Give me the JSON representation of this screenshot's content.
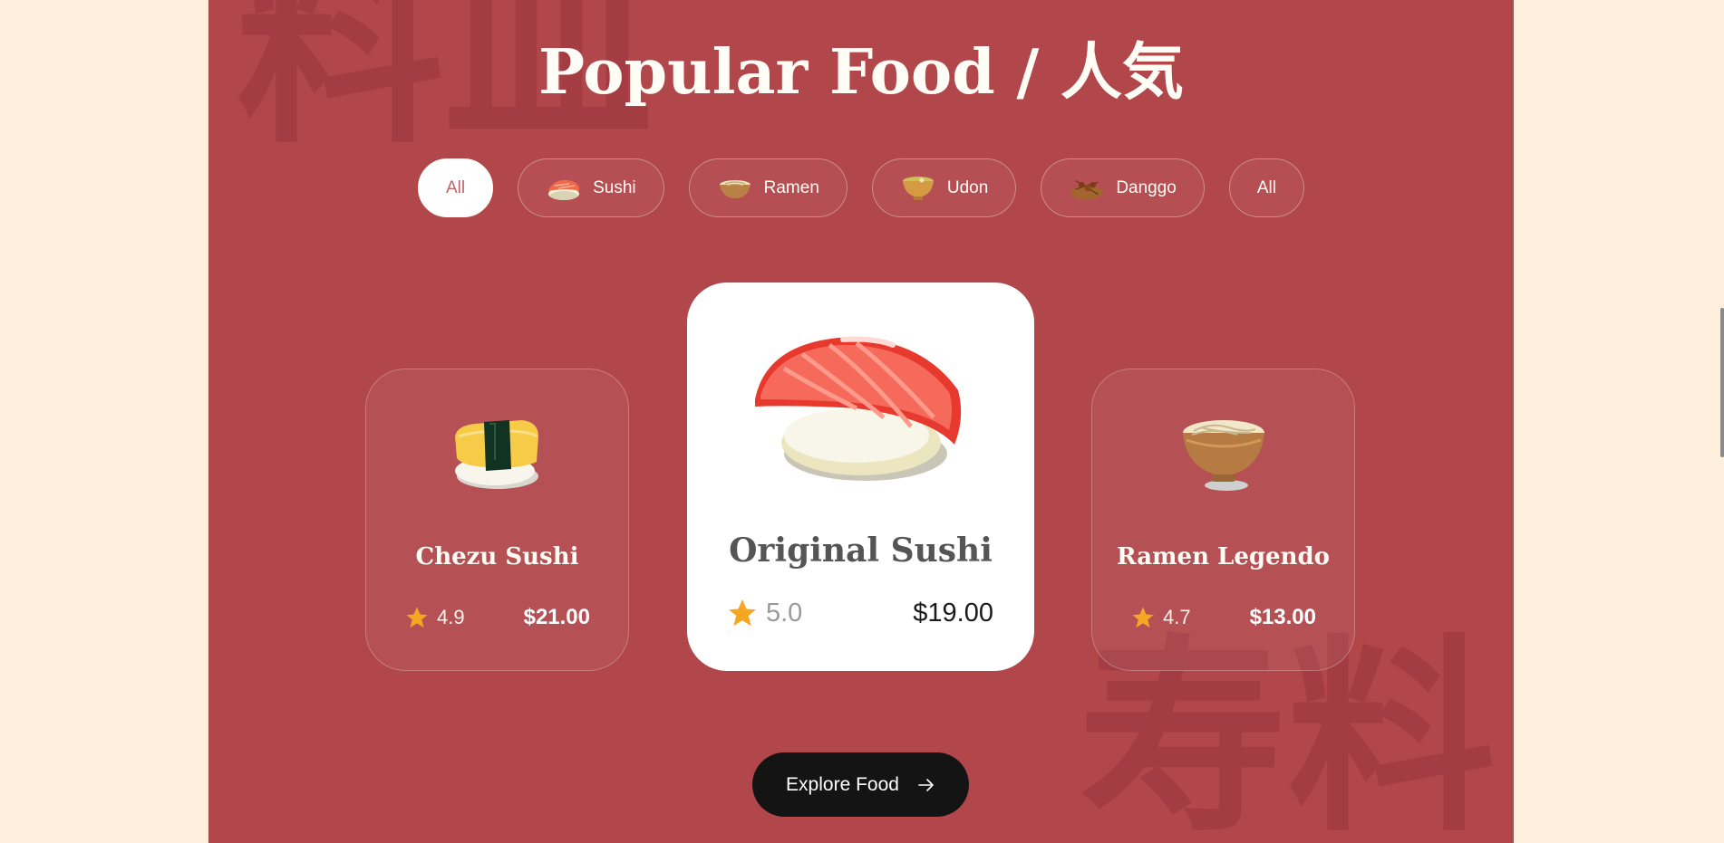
{
  "header": {
    "title": "Popular Food / 人気"
  },
  "background_kanji": {
    "top_left": "料皿",
    "bottom_right": "寿料"
  },
  "filters": [
    {
      "label": "All",
      "icon": "",
      "active": true
    },
    {
      "label": "Sushi",
      "icon": "sushi-icon",
      "active": false
    },
    {
      "label": "Ramen",
      "icon": "ramen-bowl-icon",
      "active": false
    },
    {
      "label": "Udon",
      "icon": "udon-bowl-icon",
      "active": false
    },
    {
      "label": "Danggo",
      "icon": "dango-plate-icon",
      "active": false
    },
    {
      "label": "All",
      "icon": "",
      "active": false
    }
  ],
  "cards": [
    {
      "name": "Chezu Sushi",
      "rating": "4.9",
      "price": "$21.00",
      "image": "tamago-sushi-image"
    },
    {
      "name": "Original Sushi",
      "rating": "5.0",
      "price": "$19.00",
      "image": "salmon-sushi-image"
    },
    {
      "name": "Ramen Legendo",
      "rating": "4.7",
      "price": "$13.00",
      "image": "ramen-bowl-image"
    }
  ],
  "cta": {
    "label": "Explore Food",
    "icon": "arrow-right-icon"
  },
  "colors": {
    "page_bg": "#fff0dd",
    "section_bg": "#b1464b",
    "star": "#f5a623",
    "button_bg": "#141414"
  }
}
